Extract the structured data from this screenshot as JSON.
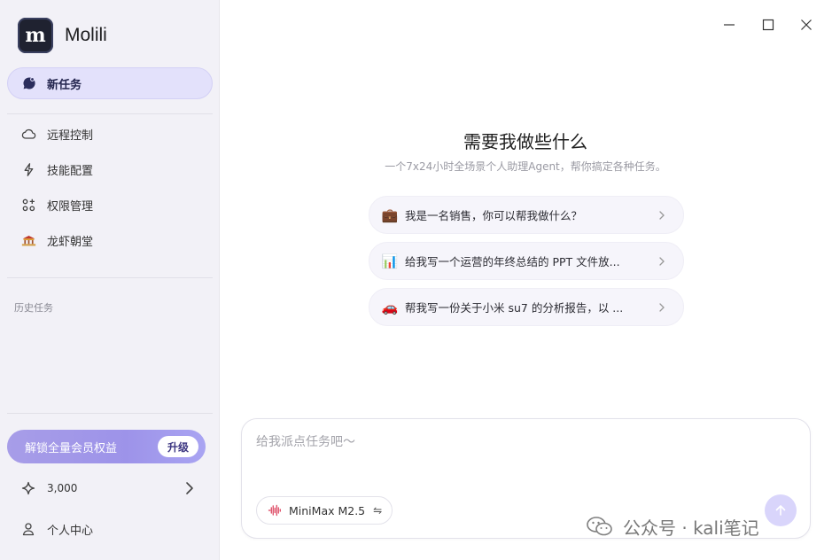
{
  "app": {
    "name": "Molili",
    "logo_text": "m"
  },
  "sidebar": {
    "new_task_label": "新任务",
    "nav": [
      {
        "label": "远程控制",
        "icon": "cloud-icon"
      },
      {
        "label": "技能配置",
        "icon": "lightning-icon"
      },
      {
        "label": "权限管理",
        "icon": "apps-grid-icon"
      },
      {
        "label": "龙虾朝堂",
        "icon": "palace-icon"
      }
    ],
    "history_title": "历史任务",
    "upgrade": {
      "label": "解锁全量会员权益",
      "button": "升级"
    },
    "points": "3,000",
    "profile_label": "个人中心"
  },
  "main": {
    "headline": "需要我做些什么",
    "subline": "一个7x24小时全场景个人助理Agent，帮你搞定各种任务。",
    "suggestions": [
      {
        "emoji": "💼",
        "text": "我是一名销售，你可以帮我做什么？"
      },
      {
        "emoji": "📊",
        "text": "给我写一个运营的年终总结的 PPT 文件放..."
      },
      {
        "emoji": "🚗",
        "text": "帮我写一份关于小米 su7 的分析报告，以 ..."
      }
    ]
  },
  "composer": {
    "placeholder": "给我派点任务吧～",
    "model": "MiniMax M2.5",
    "switch_glyph": "⇋"
  },
  "watermark": "公众号 · kali笔记",
  "colors": {
    "accent": "#e3e1fb",
    "sidebar_bg": "#f2f1f7",
    "upgrade_gradient_start": "#a79de8",
    "send_button": "#d9d5fb"
  }
}
